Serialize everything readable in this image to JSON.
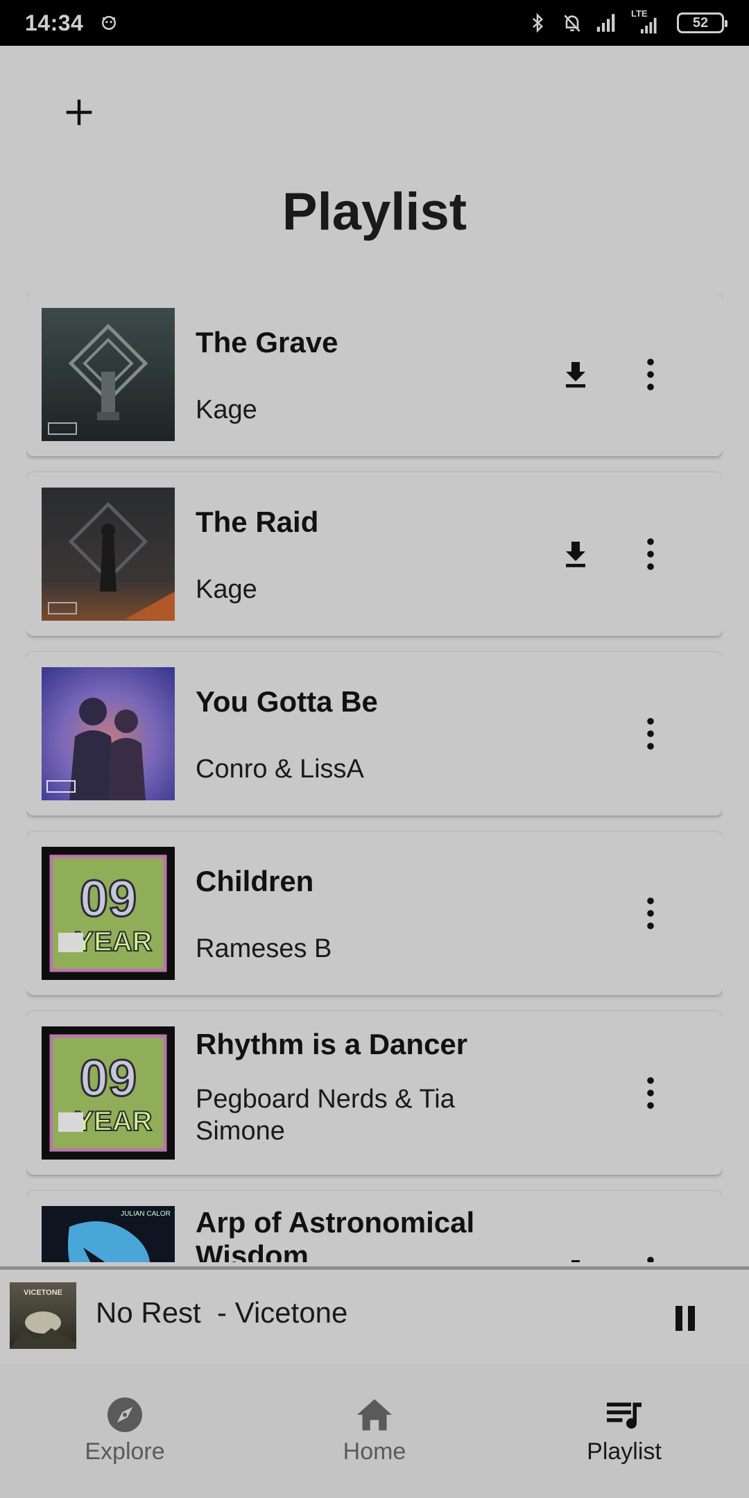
{
  "status_bar": {
    "time": "14:34",
    "battery": "52",
    "network_label": "LTE",
    "icons": [
      "app-notification-icon",
      "bluetooth-icon",
      "notifications-off-icon",
      "signal-icon",
      "lte-signal-icon",
      "battery-icon"
    ]
  },
  "header": {
    "add_icon": "plus-icon",
    "title": "Playlist"
  },
  "tracks": [
    {
      "title": "The Grave",
      "artist": "Kage",
      "downloadable": true
    },
    {
      "title": "The Raid",
      "artist": "Kage",
      "downloadable": true
    },
    {
      "title": "You Gotta Be",
      "artist": "Conro & LissA",
      "downloadable": false
    },
    {
      "title": "Children",
      "artist": "Rameses B",
      "downloadable": false
    },
    {
      "title": "Rhythm is a Dancer",
      "artist": "Pegboard Nerds & Tia Simone",
      "downloadable": false
    },
    {
      "title": "Arp of Astronomical Wisdom",
      "artist": "",
      "downloadable": true
    }
  ],
  "cover_art_text": {
    "nine_year": [
      "09",
      "YEAR"
    ],
    "julian": "JULIAN CALOR",
    "vicetone": "VICETONE"
  },
  "now_playing": {
    "title": "No Rest  - Vicetone",
    "control_icon": "pause-icon"
  },
  "bottom_nav": [
    {
      "label": "Explore",
      "icon": "compass-icon",
      "active": false
    },
    {
      "label": "Home",
      "icon": "home-icon",
      "active": false
    },
    {
      "label": "Playlist",
      "icon": "playlist-icon",
      "active": true
    }
  ],
  "colors": {
    "background": "#c8c8c8",
    "status_bar": "#000000",
    "text_primary": "#111111",
    "nav_inactive": "#5a5a5a"
  }
}
